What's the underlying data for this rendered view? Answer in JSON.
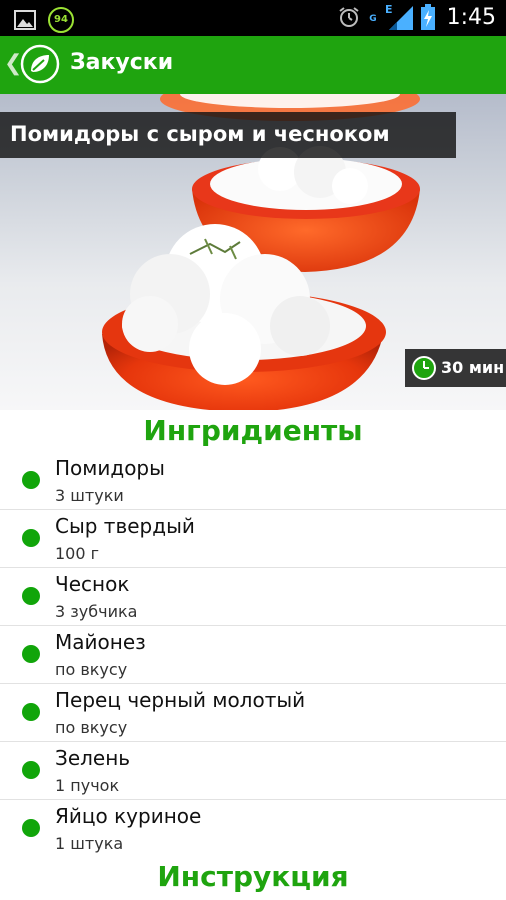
{
  "status_bar": {
    "notification_icons": [
      "gallery-icon",
      "battery-percent-icon"
    ],
    "battery_percent": "94",
    "system_icons": [
      "alarm-icon",
      "network-type-g",
      "network-type-e",
      "signal-icon",
      "battery-charging-icon"
    ],
    "network_g": "G",
    "network_e": "E",
    "time": "1:45"
  },
  "action_bar": {
    "title": "Закуски",
    "back_icon": "chevron-left-icon",
    "logo_icon": "leaf-logo-icon",
    "color": "#1fa40f"
  },
  "recipe": {
    "title": "Помидоры с сыром и чесноком",
    "time": "30 мин",
    "time_icon": "clock-icon"
  },
  "ingredients_heading": "Ингридиенты",
  "ingredients": [
    {
      "name": "Помидоры",
      "qty": "3 штуки"
    },
    {
      "name": "Сыр твердый",
      "qty": "100 г"
    },
    {
      "name": "Чеснок",
      "qty": "3 зубчика"
    },
    {
      "name": "Майонез",
      "qty": "по вкусу"
    },
    {
      "name": "Перец черный молотый",
      "qty": "по вкусу"
    },
    {
      "name": "Зелень",
      "qty": "1 пучок"
    },
    {
      "name": "Яйцо куриное",
      "qty": "1 штука"
    }
  ],
  "instructions_heading": "Инструкция",
  "colors": {
    "accent_green": "#1fa40f",
    "bullet_green": "#11a50a"
  }
}
